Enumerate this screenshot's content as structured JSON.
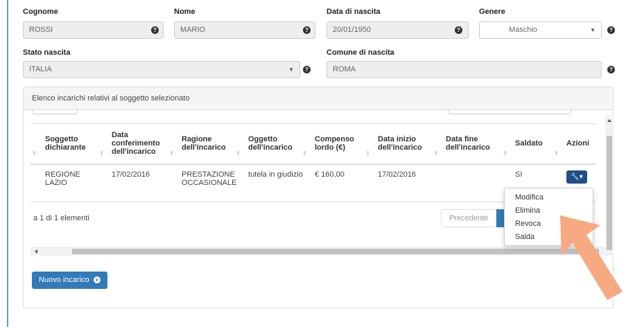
{
  "form": {
    "cognome": {
      "label": "Cognome",
      "value": "ROSSI"
    },
    "nome": {
      "label": "Nome",
      "value": "MARIO"
    },
    "data_nascita": {
      "label": "Data di nascita",
      "value": "20/01/1950"
    },
    "genere": {
      "label": "Genere",
      "value": "Maschio"
    },
    "stato_nascita": {
      "label": "Stato nascita",
      "value": "ITALIA"
    },
    "comune_nascita": {
      "label": "Comune di nascita",
      "value": "ROMA"
    },
    "help_glyph": "?",
    "caret_glyph": "▼"
  },
  "panel": {
    "title": "Elenco incarichi relativi al soggetto selezionato",
    "columns": [
      {
        "line1": "Soggetto",
        "line2": "dichiarante"
      },
      {
        "line0": "Data",
        "line1": "conferimento",
        "line2": "dell'incarico"
      },
      {
        "line1": "Ragione",
        "line2": "dell'incarico"
      },
      {
        "line1": "Oggetto",
        "line2": "dell'incarico"
      },
      {
        "line1": "Compenso",
        "line2": "lordo (€)"
      },
      {
        "line1": "Data inizio",
        "line2": "dell'incarico"
      },
      {
        "line1": "Data fine",
        "line2": "dell'incarico"
      },
      {
        "line1": "Saldato"
      },
      {
        "line1": "Azioni"
      }
    ],
    "rows": [
      {
        "soggetto": {
          "line1": "REGIONE",
          "line2": "LAZIO"
        },
        "data_conferimento": "17/02/2016",
        "ragione": {
          "line1": "PRESTAZIONE",
          "line2": "OCCASIONALE"
        },
        "oggetto": "tutela in giudizio",
        "compenso": "€ 160,00",
        "data_inizio": "17/02/2016",
        "data_fine": "",
        "saldato": "SI",
        "azioni_glyph": "🔧▾"
      }
    ],
    "pagination": {
      "info": "a 1 di 1 elementi",
      "prev": "Precedente"
    },
    "new_button": "Nuovo incarico",
    "plus_glyph": "+",
    "menu": [
      "Modifica",
      "Elimina",
      "Revoca",
      "Salda"
    ]
  },
  "colors": {
    "primary": "#337ab7",
    "action_button": "#1f4f86",
    "pointer_arrow": "#f7a982"
  }
}
